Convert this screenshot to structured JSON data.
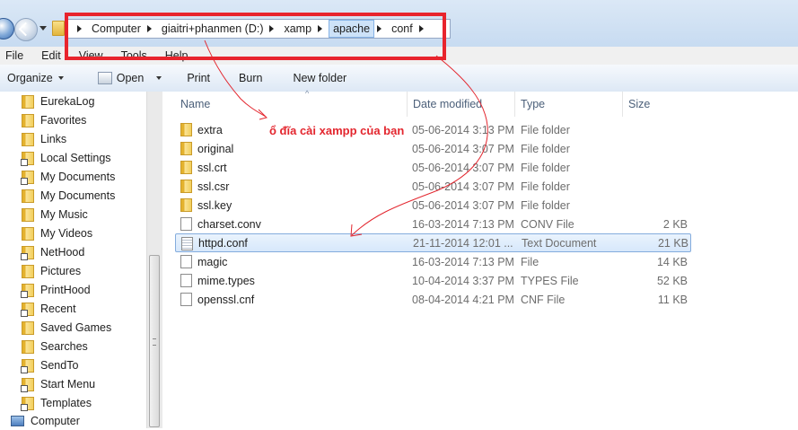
{
  "address": {
    "crumbs": [
      "Computer",
      "giaitri+phanmen (D:)",
      "xamp",
      "apache",
      "conf"
    ]
  },
  "menu": {
    "file": "File",
    "edit": "Edit",
    "view": "View",
    "tools": "Tools",
    "help": "Help"
  },
  "toolbar": {
    "organize": "Organize",
    "open": "Open",
    "print": "Print",
    "burn": "Burn",
    "new_folder": "New folder"
  },
  "sidebar": {
    "items": [
      {
        "label": "EurekaLog",
        "icon": "folder-icon"
      },
      {
        "label": "Favorites",
        "icon": "folder-icon"
      },
      {
        "label": "Links",
        "icon": "folder-icon"
      },
      {
        "label": "Local Settings",
        "icon": "shortcut-folder-icon"
      },
      {
        "label": "My Documents",
        "icon": "shortcut-folder-icon"
      },
      {
        "label": "My Documents",
        "icon": "folder-icon"
      },
      {
        "label": "My Music",
        "icon": "folder-icon"
      },
      {
        "label": "My Videos",
        "icon": "folder-icon"
      },
      {
        "label": "NetHood",
        "icon": "shortcut-folder-icon"
      },
      {
        "label": "Pictures",
        "icon": "folder-icon"
      },
      {
        "label": "PrintHood",
        "icon": "shortcut-folder-icon"
      },
      {
        "label": "Recent",
        "icon": "shortcut-folder-icon"
      },
      {
        "label": "Saved Games",
        "icon": "folder-icon"
      },
      {
        "label": "Searches",
        "icon": "folder-icon"
      },
      {
        "label": "SendTo",
        "icon": "shortcut-folder-icon"
      },
      {
        "label": "Start Menu",
        "icon": "shortcut-folder-icon"
      },
      {
        "label": "Templates",
        "icon": "shortcut-folder-icon"
      }
    ],
    "computer": "Computer"
  },
  "columns": {
    "name": "Name",
    "date": "Date modified",
    "type": "Type",
    "size": "Size"
  },
  "files": [
    {
      "name": "extra",
      "date": "05-06-2014 3:13 PM",
      "type": "File folder",
      "size": "",
      "icon": "folder-icon"
    },
    {
      "name": "original",
      "date": "05-06-2014 3:07 PM",
      "type": "File folder",
      "size": "",
      "icon": "folder-icon"
    },
    {
      "name": "ssl.crt",
      "date": "05-06-2014 3:07 PM",
      "type": "File folder",
      "size": "",
      "icon": "folder-icon"
    },
    {
      "name": "ssl.csr",
      "date": "05-06-2014 3:07 PM",
      "type": "File folder",
      "size": "",
      "icon": "folder-icon"
    },
    {
      "name": "ssl.key",
      "date": "05-06-2014 3:07 PM",
      "type": "File folder",
      "size": "",
      "icon": "folder-icon"
    },
    {
      "name": "charset.conv",
      "date": "16-03-2014 7:13 PM",
      "type": "CONV File",
      "size": "2 KB",
      "icon": "file-icon"
    },
    {
      "name": "httpd.conf",
      "date": "21-11-2014 12:01 ...",
      "type": "Text Document",
      "size": "21 KB",
      "icon": "text-file-icon",
      "selected": true
    },
    {
      "name": "magic",
      "date": "16-03-2014 7:13 PM",
      "type": "File",
      "size": "14 KB",
      "icon": "file-icon"
    },
    {
      "name": "mime.types",
      "date": "10-04-2014 3:37 PM",
      "type": "TYPES File",
      "size": "52 KB",
      "icon": "file-icon"
    },
    {
      "name": "openssl.cnf",
      "date": "08-04-2014 4:21 PM",
      "type": "CNF File",
      "size": "11 KB",
      "icon": "file-icon"
    }
  ],
  "annotation": {
    "text": "ổ đĩa cài xampp của bạn",
    "color": "#e3262e"
  }
}
